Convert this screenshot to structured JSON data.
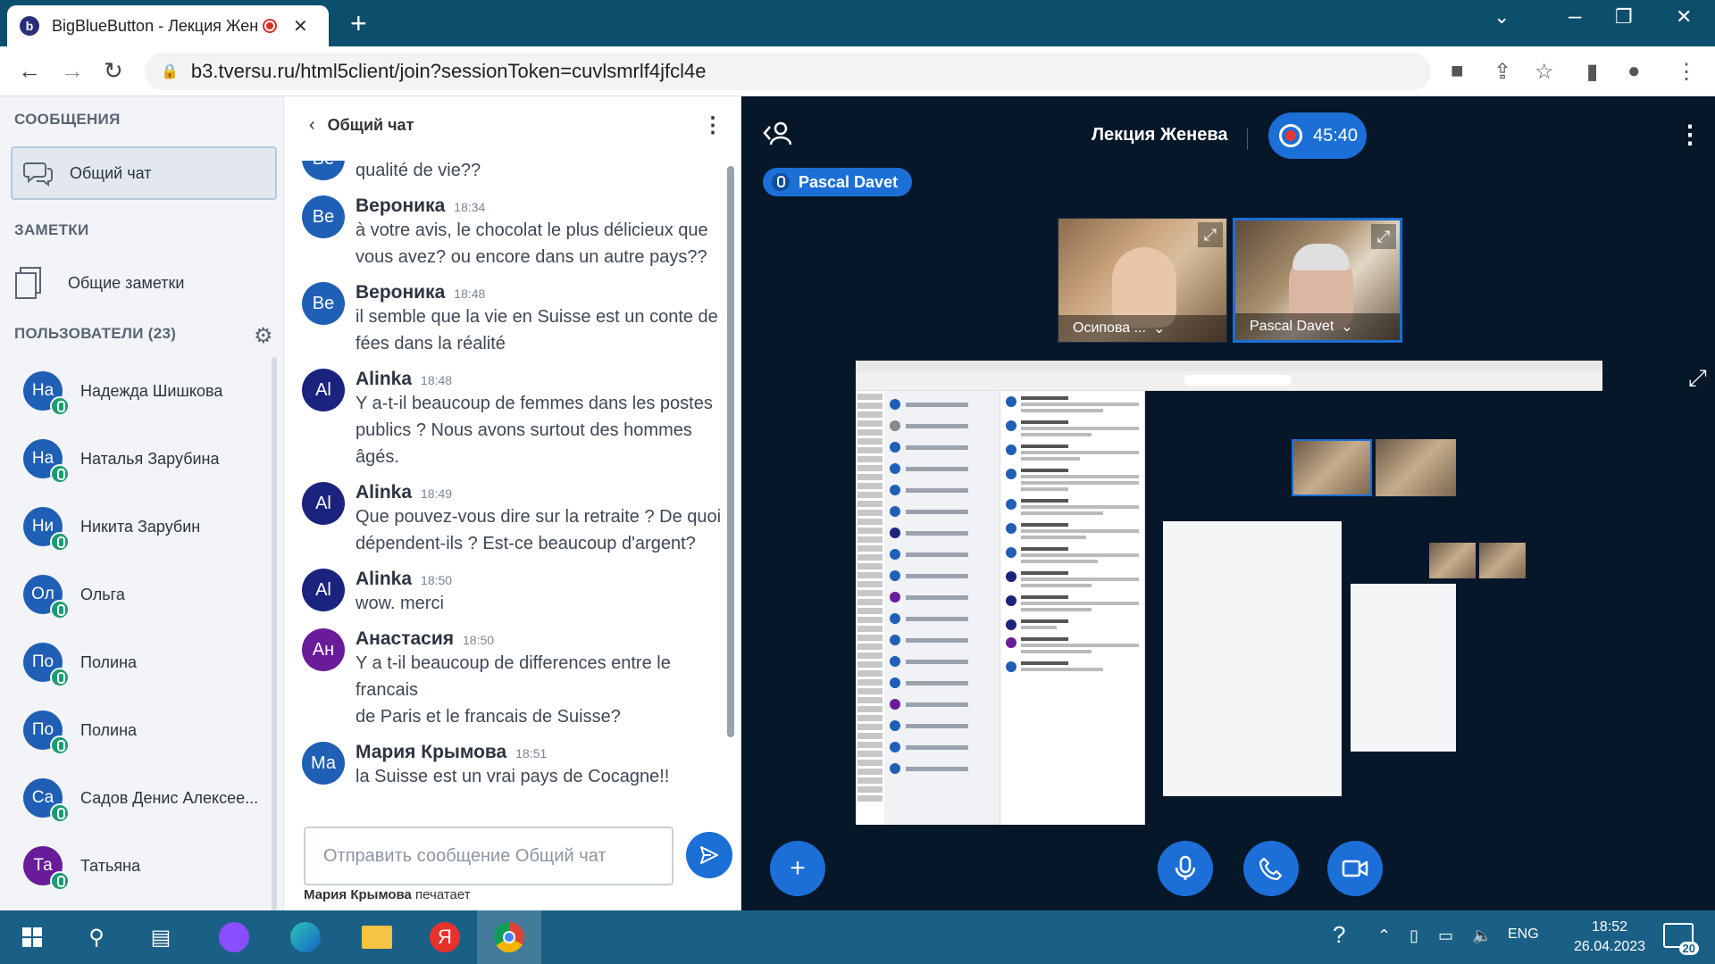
{
  "browser": {
    "tab_title": "BigBlueButton - Лекция Женева",
    "tab_icon_letter": "b",
    "url": "b3.tversu.ru/html5client/join?sessionToken=cuvlsmrlf4jfcl4e"
  },
  "sidebar": {
    "messages_header": "СООБЩЕНИЯ",
    "public_chat_label": "Общий чат",
    "notes_header": "ЗАМЕТКИ",
    "shared_notes_label": "Общие заметки",
    "users_header": "ПОЛЬЗОВАТЕЛИ (23)",
    "users": [
      {
        "initials": "На",
        "name": "Надежда Шишкова",
        "color": "#1f5fb5"
      },
      {
        "initials": "На",
        "name": "Наталья Зарубина",
        "color": "#1f5fb5"
      },
      {
        "initials": "Ни",
        "name": "Никита Зарубин",
        "color": "#1f5fb5"
      },
      {
        "initials": "Ол",
        "name": "Ольга",
        "color": "#1f5fb5"
      },
      {
        "initials": "По",
        "name": "Полина",
        "color": "#1f5fb5"
      },
      {
        "initials": "По",
        "name": "Полина",
        "color": "#1f5fb5"
      },
      {
        "initials": "Са",
        "name": "Садов Денис Алексее...",
        "color": "#1f5fb5"
      },
      {
        "initials": "Та",
        "name": "Татьяна",
        "color": "#6a1b9a"
      }
    ]
  },
  "chat": {
    "title": "Общий чат",
    "partial_top_initials": "Be",
    "partial_top_text": "qualité de vie??",
    "messages": [
      {
        "initials": "Be",
        "color": "#1f5fb5",
        "name": "Вероника",
        "time": "18:34",
        "lines": [
          "à votre avis, le chocolat le plus délicieux que",
          "vous avez? ou encore dans un autre pays??"
        ]
      },
      {
        "initials": "Be",
        "color": "#1f5fb5",
        "name": "Вероника",
        "time": "18:48",
        "lines": [
          "il semble que la vie en Suisse est un conte de",
          "fées dans la réalité"
        ]
      },
      {
        "initials": "Al",
        "color": "#1a237e",
        "name": "Alinka",
        "time": "18:48",
        "lines": [
          "Y a-t-il beaucoup de femmes dans les postes",
          "publics ? Nous avons surtout des hommes âgés."
        ]
      },
      {
        "initials": "Al",
        "color": "#1a237e",
        "name": "Alinka",
        "time": "18:49",
        "lines": [
          "Que pouvez-vous dire sur la retraite ? De quoi",
          "dépendent-ils ? Est-ce beaucoup d'argent?"
        ]
      },
      {
        "initials": "Al",
        "color": "#1a237e",
        "name": "Alinka",
        "time": "18:50",
        "lines": [
          "wow. merci"
        ]
      },
      {
        "initials": "Ан",
        "color": "#6a1b9a",
        "name": "Анастасия",
        "time": "18:50",
        "lines": [
          "Y a t-il beaucoup de differences entre le francais",
          "de Paris et le francais de Suisse?"
        ]
      },
      {
        "initials": "Ма",
        "color": "#1f5fb5",
        "name": "Мария Крымова",
        "time": "18:51",
        "lines": [
          "la Suisse est un vrai pays de Cocagne!!"
        ]
      }
    ],
    "input_placeholder": "Отправить сообщение Общий чат",
    "typing_user": "Мария Крымова",
    "typing_suffix": " печатает"
  },
  "stage": {
    "meeting_name": "Лекция Женева",
    "recording_time": "45:40",
    "talking_indicator": "Pascal Davet",
    "videos": [
      {
        "name": "Осипова ..."
      },
      {
        "name": "Pascal Davet"
      }
    ]
  },
  "taskbar": {
    "lang": "ENG",
    "time": "18:52",
    "date": "26.04.2023",
    "notifications": "20"
  },
  "colors": {
    "accent": "#1b6fd6",
    "stage_bg": "#06172a",
    "mic_green": "#1a9c70"
  }
}
